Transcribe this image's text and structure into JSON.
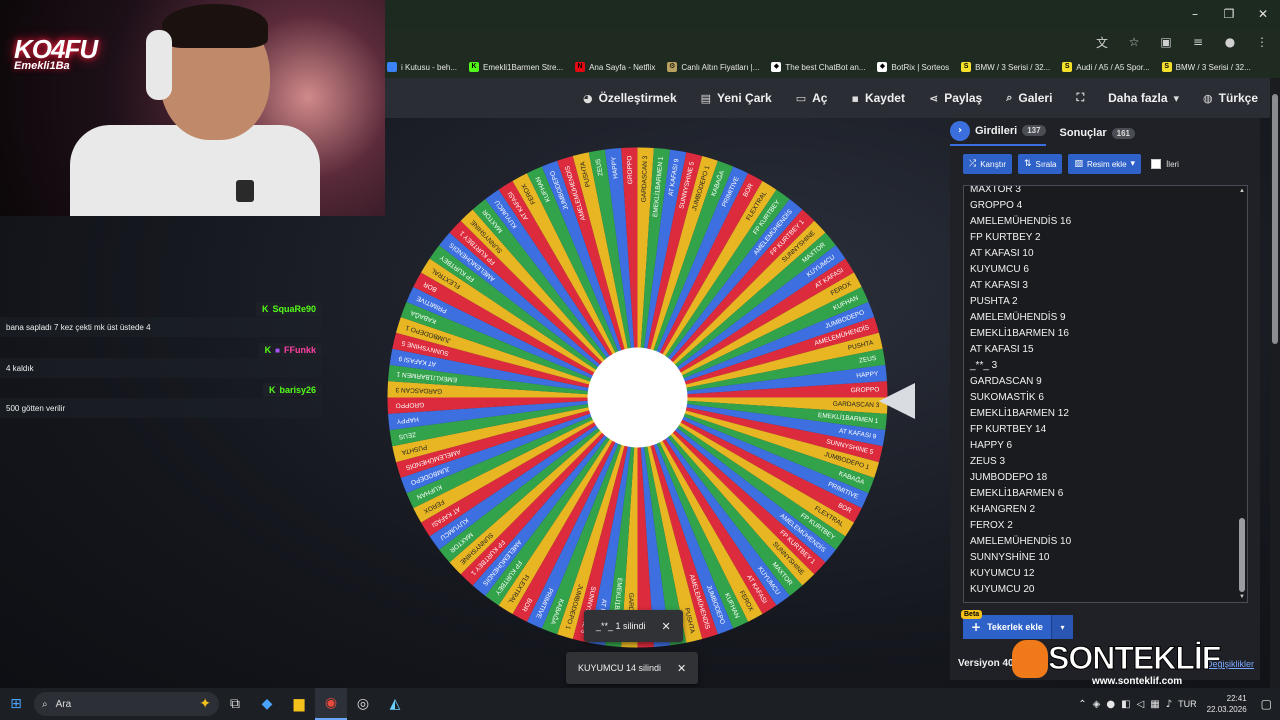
{
  "browser": {
    "window_controls": [
      "–",
      "❐",
      "✕"
    ],
    "bookmarks": [
      {
        "label": "i Kutusu - beh...",
        "color": "#3b82f6",
        "glyph": ""
      },
      {
        "label": "Emekli1Barmen Stre...",
        "color": "#53fc18",
        "glyph": "K"
      },
      {
        "label": "Ana Sayfa - Netflix",
        "color": "#e50914",
        "glyph": "N"
      },
      {
        "label": "Canlı Altın Fiyatları |...",
        "color": "#b8a060",
        "glyph": "⚙"
      },
      {
        "label": "The best ChatBot an...",
        "color": "#ffffff",
        "glyph": "◆"
      },
      {
        "label": "BotRix | Sorteos",
        "color": "#ffffff",
        "glyph": "◆"
      },
      {
        "label": "BMW / 3 Serisi / 32...",
        "color": "#f4e02b",
        "glyph": "S"
      },
      {
        "label": "Audi / A5 / A5 Spor...",
        "color": "#f4e02b",
        "glyph": "S"
      },
      {
        "label": "BMW / 3 Serisi / 32...",
        "color": "#f4e02b",
        "glyph": "S"
      }
    ]
  },
  "nav": {
    "customize": "Özelleştirmek",
    "new_wheel": "Yeni Çark",
    "open": "Aç",
    "save": "Kaydet",
    "share": "Paylaş",
    "gallery": "Galeri",
    "more": "Daha fazla",
    "language": "Türkçe"
  },
  "webcam": {
    "logo": "KO4FU",
    "logo_sub": "Emekli1Ba"
  },
  "chat": [
    {
      "user": "SquaRe90",
      "user_color": "#53fc18",
      "message": "bana sapladı 7 kez çekti mk üst üstede 4"
    },
    {
      "user": "FFunkk",
      "user_color": "#ff3fa4",
      "message": "4 kaldık"
    },
    {
      "user": "barisy26",
      "user_color": "#53fc18",
      "message": "500 götten verilir"
    }
  ],
  "panel": {
    "tab_entries": {
      "label": "Girdileri",
      "count": "137"
    },
    "tab_results": {
      "label": "Sonuçlar",
      "count": "161"
    },
    "shuffle": "Karıştır",
    "sort": "Sırala",
    "add_image": "Resim ekle",
    "advanced": "İleri",
    "entries": [
      "MAXTOR 3",
      "GROPPO 4",
      "AMELEMÜHENDİS 16",
      "FP KURTBEY 2",
      "AT KAFASI 10",
      "KUYUMCU 6",
      "AT KAFASI 3",
      "PUSHTA 2",
      "AMELEMÜHENDİS 9",
      "EMEKLİ1BARMEN 16",
      "AT KAFASI 15",
      "_**_ 3",
      "GARDASCAN 9",
      "SUKOMASTİK 6",
      "EMEKLİ1BARMEN 12",
      "FP KURTBEY 14",
      "HAPPY 6",
      "ZEUS 3",
      "JUMBODEPO 18",
      "EMEKLİ1BARMEN 6",
      "KHANGREN 2",
      "FEROX 2",
      "AMELEMÜHENDİS 10",
      "SUNNYSHİNE 10",
      "KUYUMCU 12",
      "KUYUMCU 20"
    ],
    "beta": "Beta",
    "add_wheel": "Tekerlek ekle",
    "version": "Versiyon 40",
    "changes": "Değişiklikler"
  },
  "wheel": {
    "colors": [
      "#e8b623",
      "#33a34b",
      "#3e6fe0",
      "#dc2b3c"
    ],
    "labels": [
      "GARDASCAN 3",
      "EMEKLİ1BARMEN 1",
      "AT KAFASI 9",
      "SUNNYSHINE 5",
      "JUMBODEPO 1",
      "KABAĞA",
      "PRIMITIVE",
      "BOR",
      "FLEXTRAL",
      "FP KURTBEY",
      "AMELEMÜHENDİS",
      "FP KURTBEY 1",
      "SUNNYSHINE",
      "MAXTOR",
      "KUYUMCU",
      "AT KAFASI",
      "FEROX",
      "KUFHAN",
      "JUMBODEPO",
      "AMELEMÜHENDİS",
      "PUSHTA",
      "ZEUS",
      "HAPPY",
      "GROPPO"
    ]
  },
  "toasts": [
    {
      "text": "_**_ 1 silindi",
      "close": "✕"
    },
    {
      "text": "KUYUMCU 14 silindi",
      "close": "✕"
    }
  ],
  "watermark": {
    "brand": "SONTEKLİF",
    "url": "www.sonteklif.com"
  },
  "taskbar": {
    "search_placeholder": "Ara",
    "language": "TUR",
    "time": "22:41",
    "date": "22.03.2026"
  }
}
